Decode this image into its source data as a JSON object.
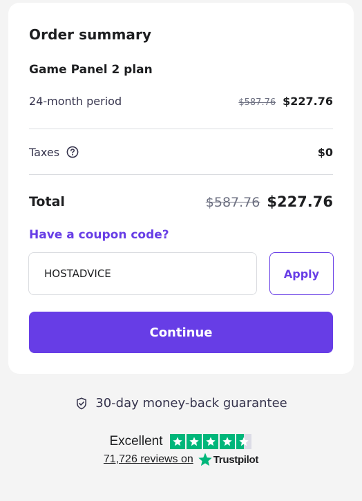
{
  "summary": {
    "title": "Order summary",
    "plan_name": "Game Panel 2 plan",
    "period_label": "24-month period",
    "period_old_price": "$587.76",
    "period_new_price": "$227.76",
    "taxes_label": "Taxes",
    "taxes_icon": "help-icon",
    "taxes_value": "$0",
    "total_label": "Total",
    "total_old_price": "$587.76",
    "total_new_price": "$227.76"
  },
  "coupon": {
    "link_text": "Have a coupon code?",
    "input_value": "HOSTADVICE",
    "apply_label": "Apply"
  },
  "continue_label": "Continue",
  "guarantee": {
    "icon": "shield-check-icon",
    "text": "30-day money-back guarantee"
  },
  "trustpilot": {
    "rating_text": "Excellent",
    "stars": 4.5,
    "reviews_text": "71,726 reviews on",
    "brand": "Trustpilot"
  },
  "colors": {
    "accent": "#673de6",
    "trust_green": "#00b67a",
    "background": "#f4f4f4"
  }
}
